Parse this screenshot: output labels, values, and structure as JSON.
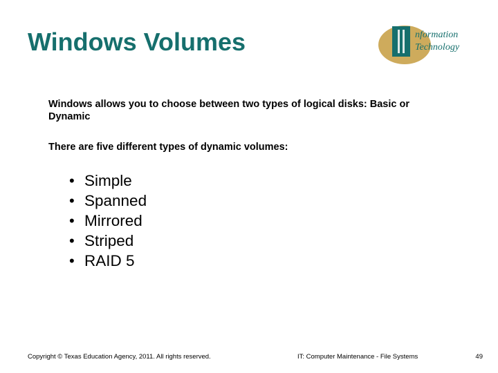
{
  "title": "Windows Volumes",
  "logo": {
    "top_text": "nformation",
    "bottom_text": "Technology"
  },
  "para1": "Windows allows you to choose between two types of logical disks: Basic or Dynamic",
  "para2": "There are five different types of dynamic volumes:",
  "volumes": {
    "0": "Simple",
    "1": "Spanned",
    "2": "Mirrored",
    "3": "Striped",
    "4": "RAID 5"
  },
  "footer": {
    "copyright": "Copyright © Texas Education Agency, 2011. All rights reserved.",
    "course": "IT: Computer Maintenance - File Systems",
    "page": "49"
  }
}
